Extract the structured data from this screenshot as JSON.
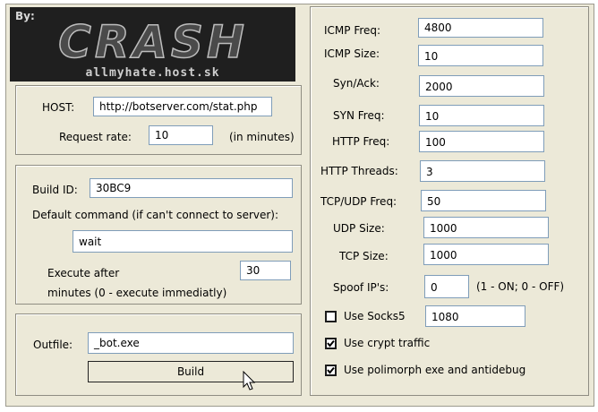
{
  "logo": {
    "by": "By:",
    "brand": "CRASH",
    "site": "allmyhate.host.sk"
  },
  "host_panel": {
    "host_label": "HOST:",
    "host_value": "http://botserver.com/stat.php",
    "rate_label": "Request rate:",
    "rate_value": "10",
    "rate_unit": "(in minutes)"
  },
  "build_panel": {
    "build_id_label": "Build ID:",
    "build_id_value": "30BC9",
    "default_cmd_label": "Default command (if can't connect to server):",
    "default_cmd_value": "wait",
    "execute_label": "Execute after",
    "execute_value": "30",
    "execute_hint": "minutes (0 - execute immediatly)"
  },
  "out_panel": {
    "outfile_label": "Outfile:",
    "outfile_value": "_bot.exe",
    "build_button": "Build"
  },
  "settings": {
    "icmp_freq_label": "ICMP Freq:",
    "icmp_freq_value": "4800",
    "icmp_size_label": "ICMP Size:",
    "icmp_size_value": "10",
    "synack_label": "Syn/Ack:",
    "synack_value": "2000",
    "syn_freq_label": "SYN Freq:",
    "syn_freq_value": "10",
    "http_freq_label": "HTTP Freq:",
    "http_freq_value": "100",
    "http_threads_label": "HTTP Threads:",
    "http_threads_value": "3",
    "tcpudp_freq_label": "TCP/UDP Freq:",
    "tcpudp_freq_value": "50",
    "udp_size_label": "UDP Size:",
    "udp_size_value": "1000",
    "tcp_size_label": "TCP Size:",
    "tcp_size_value": "1000",
    "spoof_label": "Spoof IP's:",
    "spoof_value": "0",
    "spoof_hint": "(1 - ON; 0 - OFF)",
    "socks_label": "Use Socks5",
    "socks_value": "1080",
    "crypt_label": "Use crypt traffic",
    "polimorph_label": "Use polimorph exe and antidebug"
  }
}
